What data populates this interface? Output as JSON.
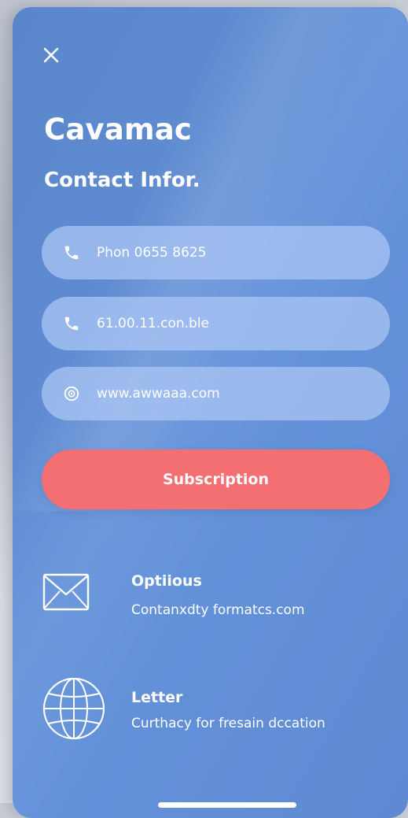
{
  "header": {
    "close_icon": "close-icon",
    "title": "Cavamac",
    "subtitle": "Contact Infor."
  },
  "fields": [
    {
      "icon": "phone-icon",
      "value": "Phon 0655 8625"
    },
    {
      "icon": "phone-icon",
      "value": "61.00.11.con.ble"
    },
    {
      "icon": "globe-icon",
      "value": "www.awwaaa.com"
    }
  ],
  "subscribe_button": {
    "label": "Subscription"
  },
  "info_rows": [
    {
      "icon": "envelope-icon",
      "title": "Optiious",
      "text": "Contanxdty formatcs.com"
    },
    {
      "icon": "globe-icon",
      "title": "Letter",
      "text": "Curthacy for fresain dccation"
    }
  ],
  "colors": {
    "card_background": "#5f8ad3",
    "field_background": "#adc8f5",
    "button_accent": "#f36f72",
    "text": "#ffffff"
  }
}
